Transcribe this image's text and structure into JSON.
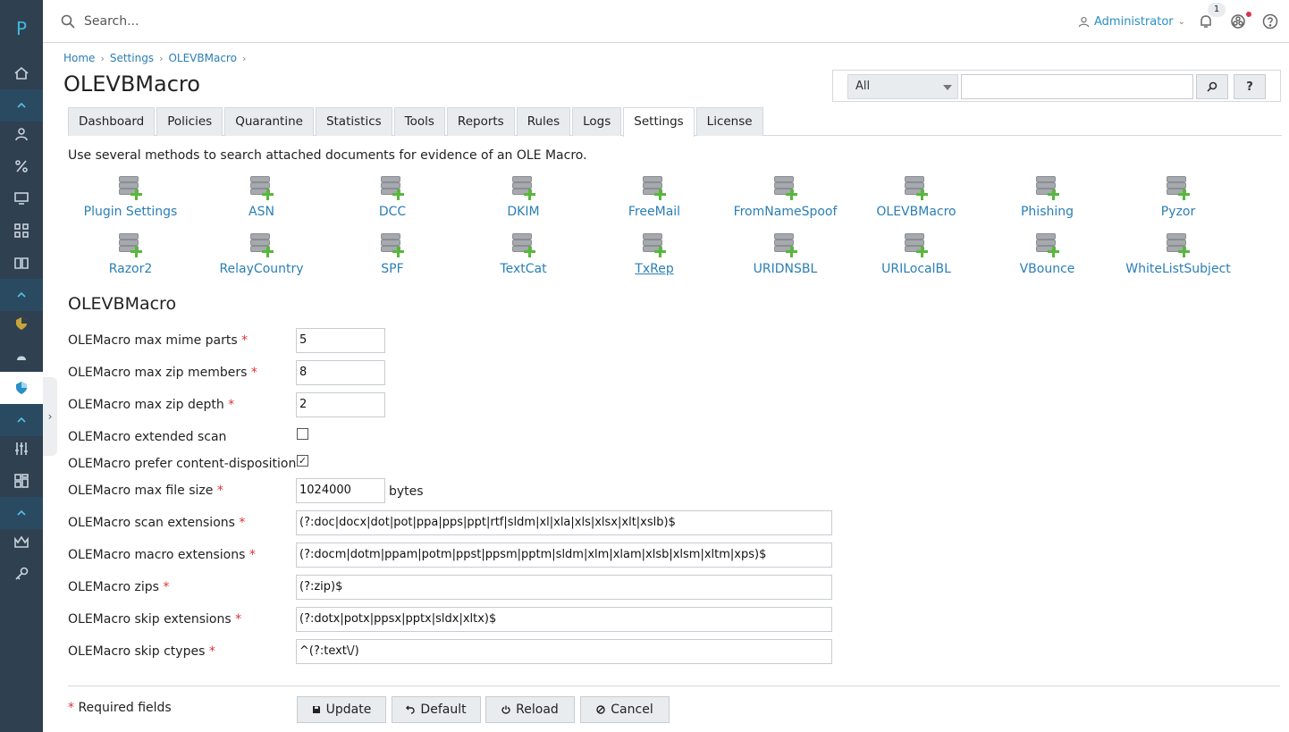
{
  "app": {
    "logo_letter": "P"
  },
  "topbar": {
    "search_placeholder": "Search...",
    "user": "Administrator",
    "notification_count": "1"
  },
  "breadcrumb": [
    "Home",
    "Settings",
    "OLEVBMacro"
  ],
  "page_title": "OLEVBMacro",
  "filter": {
    "select_value": "All",
    "help_label": "?"
  },
  "tabs": [
    "Dashboard",
    "Policies",
    "Quarantine",
    "Statistics",
    "Tools",
    "Reports",
    "Rules",
    "Logs",
    "Settings",
    "License"
  ],
  "active_tab": "Settings",
  "description": "Use several methods to search attached documents for evidence of an OLE Macro.",
  "plugins": {
    "row1": [
      "Plugin Settings",
      "ASN",
      "DCC",
      "DKIM",
      "FreeMail",
      "FromNameSpoof",
      "OLEVBMacro",
      "Phishing",
      "Pyzor"
    ],
    "row2": [
      "Razor2",
      "RelayCountry",
      "SPF",
      "TextCat",
      "TxRep",
      "URIDNSBL",
      "URILocalBL",
      "VBounce",
      "WhiteListSubject"
    ]
  },
  "section_title": "OLEVBMacro",
  "form": {
    "max_mime_parts": {
      "label": "OLEMacro max mime parts",
      "value": "5"
    },
    "max_zip_members": {
      "label": "OLEMacro max zip members",
      "value": "8"
    },
    "max_zip_depth": {
      "label": "OLEMacro max zip depth",
      "value": "2"
    },
    "extended_scan": {
      "label": "OLEMacro extended scan",
      "checked": false
    },
    "prefer_content_disposition": {
      "label": "OLEMacro prefer content-disposition",
      "checked": true
    },
    "max_file_size": {
      "label": "OLEMacro max file size",
      "value": "1024000",
      "unit": "bytes"
    },
    "scan_extensions": {
      "label": "OLEMacro scan extensions",
      "value": "(?:doc|docx|dot|pot|ppa|pps|ppt|rtf|sldm|xl|xla|xls|xlsx|xlt|xslb)$"
    },
    "macro_extensions": {
      "label": "OLEMacro macro extensions",
      "value": "(?:docm|dotm|ppam|potm|ppst|ppsm|pptm|sldm|xlm|xlam|xlsb|xlsm|xltm|xps)$"
    },
    "zips": {
      "label": "OLEMacro zips",
      "value": "(?:zip)$"
    },
    "skip_extensions": {
      "label": "OLEMacro skip extensions",
      "value": "(?:dotx|potx|ppsx|pptx|sldx|xltx)$"
    },
    "skip_ctypes": {
      "label": "OLEMacro skip ctypes",
      "value": "^(?:text\\/)"
    }
  },
  "required_star": "*",
  "required_note": "Required fields",
  "buttons": {
    "update": "Update",
    "default": "Default",
    "reload": "Reload",
    "cancel": "Cancel"
  }
}
